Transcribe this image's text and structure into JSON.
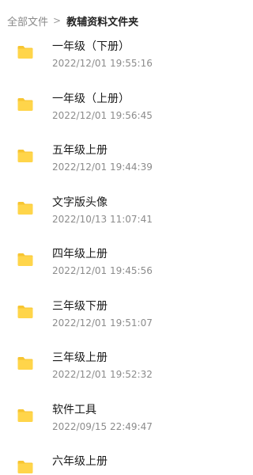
{
  "breadcrumb": {
    "root": "全部文件",
    "separator": ">",
    "current": "教辅资料文件夹"
  },
  "files": [
    {
      "name": "一年级（下册）",
      "date": "2022/12/01 19:55:16",
      "icon": "folder-icon"
    },
    {
      "name": "一年级（上册）",
      "date": "2022/12/01 19:56:45",
      "icon": "folder-icon"
    },
    {
      "name": "五年级上册",
      "date": "2022/12/01 19:44:39",
      "icon": "folder-icon"
    },
    {
      "name": "文字版头像",
      "date": "2022/10/13 11:07:41",
      "icon": "folder-icon"
    },
    {
      "name": "四年级上册",
      "date": "2022/12/01 19:45:56",
      "icon": "folder-icon"
    },
    {
      "name": "三年级下册",
      "date": "2022/12/01 19:51:07",
      "icon": "folder-icon"
    },
    {
      "name": "三年级上册",
      "date": "2022/12/01 19:52:32",
      "icon": "folder-icon"
    },
    {
      "name": "软件工具",
      "date": "2022/09/15 22:49:47",
      "icon": "folder-icon"
    },
    {
      "name": "六年级上册",
      "date": "",
      "icon": "folder-icon"
    }
  ],
  "colors": {
    "folder": "#FFD54A",
    "folder_tab": "#F7C531"
  }
}
